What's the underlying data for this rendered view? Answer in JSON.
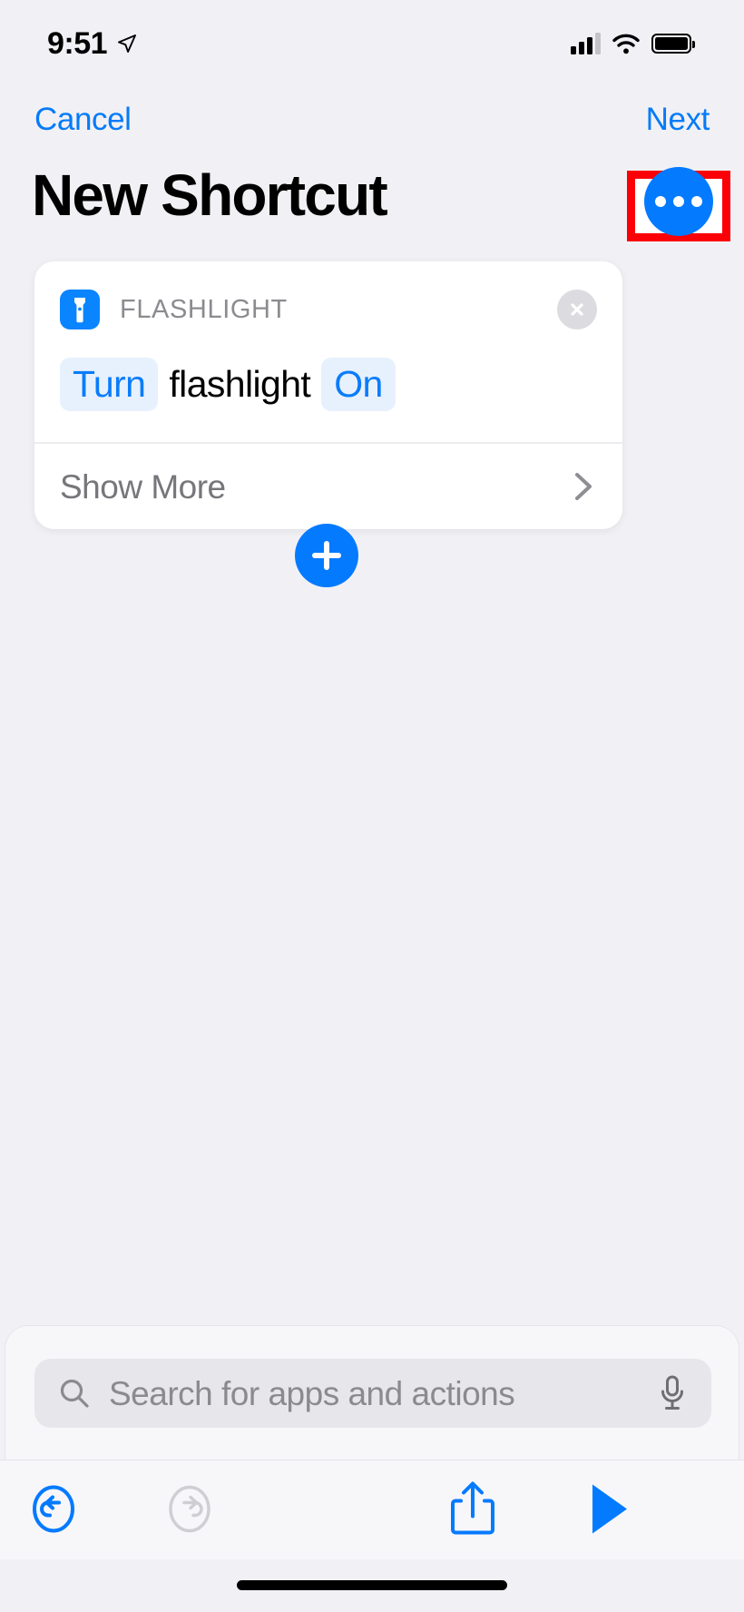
{
  "status_bar": {
    "time": "9:51",
    "location_icon": "location-arrow-icon",
    "signal_icon": "cellular-signal-icon",
    "wifi_icon": "wifi-icon",
    "battery_icon": "battery-full-icon",
    "battery_level_pct": 100
  },
  "nav": {
    "cancel_label": "Cancel",
    "next_label": "Next",
    "title": "New Shortcut",
    "more_button_icon": "ellipsis-icon",
    "more_button_color": "#047AFF"
  },
  "annotation": {
    "color": "#FB0007",
    "target": "more-options-button"
  },
  "action_card": {
    "app_icon": "flashlight-icon",
    "app_icon_color": "#0A84FF",
    "app_name": "FLASHLIGHT",
    "close_icon": "close-circle-icon",
    "tokens": [
      {
        "text": "Turn",
        "type": "parameter"
      },
      {
        "text": "flashlight",
        "type": "plain"
      },
      {
        "text": "On",
        "type": "parameter"
      }
    ],
    "token_color": "#0A7CFA",
    "token_background": "#E7F1FE",
    "show_more_label": "Show More",
    "show_more_chevron": "chevron-right-icon"
  },
  "add_action": {
    "icon": "plus-icon",
    "color": "#047AFF"
  },
  "search": {
    "placeholder": "Search for apps and actions",
    "value": "",
    "search_icon": "search-icon",
    "mic_icon": "microphone-icon"
  },
  "toolbar": {
    "undo": {
      "icon": "undo-icon",
      "enabled": true,
      "color": "#047AFF"
    },
    "redo": {
      "icon": "redo-icon",
      "enabled": false,
      "color": "#C9C9CE"
    },
    "share": {
      "icon": "share-icon",
      "enabled": true,
      "color": "#047AFF"
    },
    "play": {
      "icon": "play-icon",
      "enabled": true,
      "color": "#047AFF"
    }
  },
  "home_indicator": "home-indicator"
}
